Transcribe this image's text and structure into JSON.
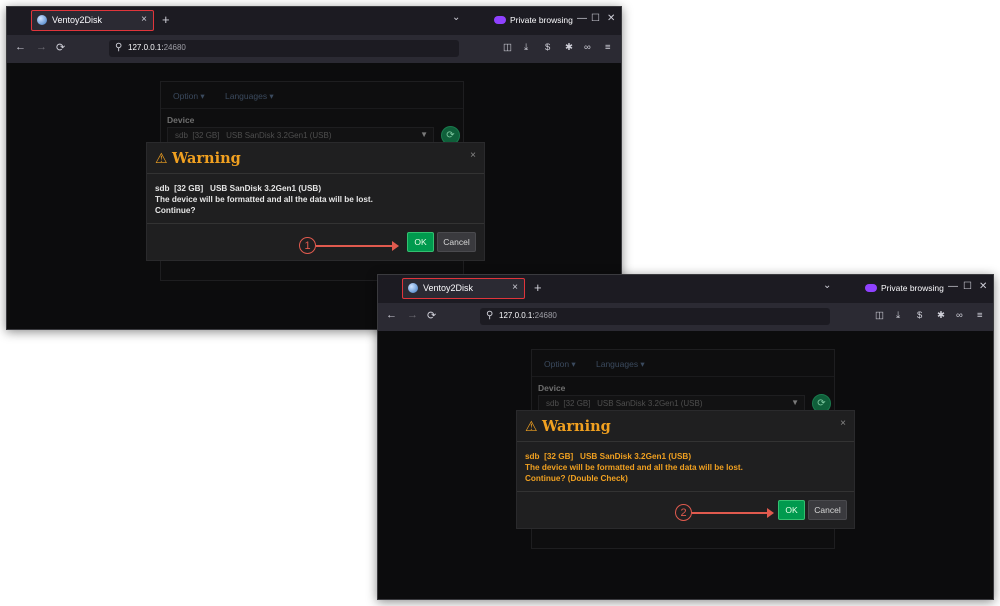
{
  "browser": {
    "tab_title": "Ventoy2Disk",
    "new_tab_label": "+",
    "private_label": "Private browsing",
    "url_host": "127.0.0.1:",
    "url_port": "24680"
  },
  "icons": {
    "tab_close": "×",
    "tabs_list": "⌄",
    "minimize": "—",
    "maximize": "☐",
    "close": "✕",
    "back": "←",
    "forward": "→",
    "reload": "⟳",
    "search": "⚲",
    "pocket": "◫",
    "download": "⤓",
    "account": "$",
    "extensions": "✱",
    "private": "∞",
    "menu": "≡",
    "warning": "⚠",
    "dialog_close": "×",
    "dropdown_arrow": "▼",
    "refresh": "⟳"
  },
  "app": {
    "menu_option": "Option ▾",
    "menu_languages": "Languages ▾",
    "device_label": "Device",
    "device_value": "sdb  [32 GB]   USB SanDisk 3.2Gen1 (USB)"
  },
  "dialog1": {
    "title": "Warning",
    "line1": "sdb  [32 GB]   USB SanDisk 3.2Gen1 (USB)",
    "line2": "The device will be formatted and all the data will be lost.",
    "line3": "Continue?",
    "ok_label": "OK",
    "cancel_label": "Cancel",
    "step": "1",
    "text_color": "#e6e6e6"
  },
  "dialog2": {
    "title": "Warning",
    "line1": "sdb  [32 GB]   USB SanDisk 3.2Gen1 (USB)",
    "line2": "The device will be formatted and all the data will be lost.",
    "line3": "Continue? (Double Check)",
    "ok_label": "OK",
    "cancel_label": "Cancel",
    "step": "2",
    "text_color": "#f0a020"
  },
  "colors": {
    "warning": "#f0a020",
    "ok_button": "#009a4e",
    "annotation": "#e05a4e",
    "tab_highlight": "#e0353b",
    "private_icon": "#8f41ff"
  }
}
